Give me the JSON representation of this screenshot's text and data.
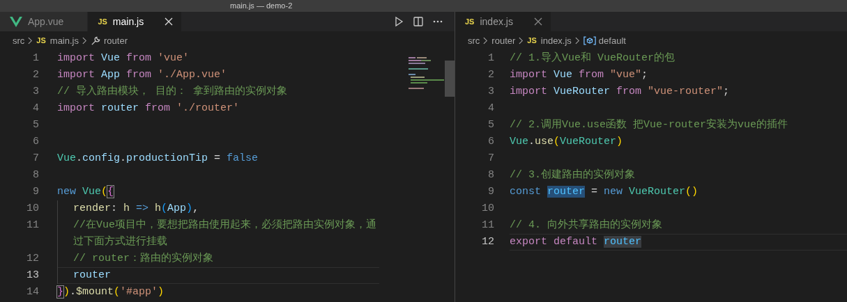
{
  "window": {
    "title": "main.js — demo-2"
  },
  "panes": [
    {
      "focused": true,
      "minimap": true,
      "actions": true,
      "tabs": [
        {
          "label": "App.vue",
          "kind": "vue",
          "selected": false,
          "closable": false
        },
        {
          "label": "main.js",
          "kind": "js",
          "icon_text": "JS",
          "selected": true,
          "closable": true
        }
      ],
      "breadcrumbs": [
        {
          "label": "src",
          "kind": "folder"
        },
        {
          "label": "main.js",
          "kind": "file",
          "icon_text": "JS"
        },
        {
          "label": "router",
          "kind": "property"
        }
      ],
      "lines": [
        {
          "number": "1",
          "current": false,
          "guide": false,
          "tokens": [
            {
              "text": "import ",
              "kind": "keyword"
            },
            {
              "text": "Vue ",
              "kind": "ident"
            },
            {
              "text": "from ",
              "kind": "keyword"
            },
            {
              "text": "'vue'",
              "kind": "string"
            }
          ]
        },
        {
          "number": "2",
          "current": false,
          "guide": false,
          "tokens": [
            {
              "text": "import ",
              "kind": "keyword"
            },
            {
              "text": "App ",
              "kind": "ident"
            },
            {
              "text": "from ",
              "kind": "keyword"
            },
            {
              "text": "'./App.vue'",
              "kind": "string"
            }
          ]
        },
        {
          "number": "3",
          "current": false,
          "guide": false,
          "tokens": [
            {
              "text": "// 导入路由模块， 目的： 拿到路由的实例对象",
              "kind": "comment"
            }
          ]
        },
        {
          "number": "4",
          "current": false,
          "guide": false,
          "tokens": [
            {
              "text": "import ",
              "kind": "keyword"
            },
            {
              "text": "router ",
              "kind": "ident"
            },
            {
              "text": "from ",
              "kind": "keyword"
            },
            {
              "text": "'./router'",
              "kind": "string"
            }
          ]
        },
        {
          "number": "5",
          "current": false,
          "guide": false
        },
        {
          "number": "6",
          "current": false,
          "guide": false
        },
        {
          "number": "7",
          "current": false,
          "guide": false,
          "tokens": [
            {
              "text": "Vue",
              "kind": "class"
            },
            {
              "text": ".",
              "kind": "plain"
            },
            {
              "text": "config",
              "kind": "ident"
            },
            {
              "text": ".",
              "kind": "plain"
            },
            {
              "text": "productionTip",
              "kind": "ident"
            },
            {
              "text": " = ",
              "kind": "plain"
            },
            {
              "text": "false",
              "kind": "storage"
            }
          ]
        },
        {
          "number": "8",
          "current": false,
          "guide": false
        },
        {
          "number": "9",
          "current": false,
          "guide": false,
          "tokens": [
            {
              "text": "new ",
              "kind": "storage"
            },
            {
              "text": "Vue",
              "kind": "class"
            },
            {
              "text": "(",
              "kind": "paren"
            },
            {
              "text": "{",
              "kind": "brace",
              "matched": true
            }
          ]
        },
        {
          "number": "10",
          "current": false,
          "guide": true,
          "tokens": [
            {
              "text": "render",
              "kind": "func"
            },
            {
              "text": ": ",
              "kind": "plain"
            },
            {
              "text": "h ",
              "kind": "func"
            },
            {
              "text": "=> ",
              "kind": "storage"
            },
            {
              "text": "h",
              "kind": "func"
            },
            {
              "text": "(",
              "kind": "paren2"
            },
            {
              "text": "App",
              "kind": "ident"
            },
            {
              "text": ")",
              "kind": "paren2"
            },
            {
              "text": ",",
              "kind": "plain"
            }
          ]
        },
        {
          "number": "11",
          "current": false,
          "guide": true,
          "tokens": [
            {
              "text": "//在Vue项目中，要想把路由使用起来，必须把路由实例对象，通过下面方式进行挂载",
              "kind": "comment"
            }
          ]
        },
        {
          "number": "12",
          "current": false,
          "guide": true,
          "tokens": [
            {
              "text": "// router：路由的实例对象",
              "kind": "comment"
            }
          ]
        },
        {
          "number": "13",
          "current": true,
          "guide": true,
          "tokens": [
            {
              "text": "router",
              "kind": "ident"
            }
          ]
        },
        {
          "number": "14",
          "current": false,
          "guide": false,
          "tokens": [
            {
              "text": "}",
              "kind": "brace",
              "matched": true
            },
            {
              "text": ")",
              "kind": "paren"
            },
            {
              "text": ".",
              "kind": "plain"
            },
            {
              "text": "$mount",
              "kind": "func"
            },
            {
              "text": "(",
              "kind": "paren"
            },
            {
              "text": "'#app'",
              "kind": "string"
            },
            {
              "text": ")",
              "kind": "paren"
            }
          ]
        }
      ]
    },
    {
      "focused": false,
      "minimap": false,
      "actions": false,
      "tabs": [
        {
          "label": "index.js",
          "kind": "js",
          "icon_text": "JS",
          "selected": true,
          "closable": true
        }
      ],
      "breadcrumbs": [
        {
          "label": "src",
          "kind": "folder"
        },
        {
          "label": "router",
          "kind": "folder"
        },
        {
          "label": "index.js",
          "kind": "file",
          "icon_text": "JS"
        },
        {
          "label": "default",
          "kind": "variable"
        }
      ],
      "lines": [
        {
          "number": "1",
          "current": false,
          "guide": false,
          "tokens": [
            {
              "text": "// 1.导入Vue和 VueRouter的包",
              "kind": "comment"
            }
          ]
        },
        {
          "number": "2",
          "current": false,
          "guide": false,
          "tokens": [
            {
              "text": "import ",
              "kind": "keyword"
            },
            {
              "text": "Vue ",
              "kind": "ident"
            },
            {
              "text": "from ",
              "kind": "keyword"
            },
            {
              "text": "\"vue\"",
              "kind": "string"
            },
            {
              "text": ";",
              "kind": "plain"
            }
          ]
        },
        {
          "number": "3",
          "current": false,
          "guide": false,
          "tokens": [
            {
              "text": "import ",
              "kind": "keyword"
            },
            {
              "text": "VueRouter ",
              "kind": "ident"
            },
            {
              "text": "from ",
              "kind": "keyword"
            },
            {
              "text": "\"vue-router\"",
              "kind": "string"
            },
            {
              "text": ";",
              "kind": "plain"
            }
          ]
        },
        {
          "number": "4",
          "current": false,
          "guide": false
        },
        {
          "number": "5",
          "current": false,
          "guide": false,
          "tokens": [
            {
              "text": "// 2.调用Vue.use函数 把Vue-router安装为vue的插件",
              "kind": "comment"
            }
          ]
        },
        {
          "number": "6",
          "current": false,
          "guide": false,
          "tokens": [
            {
              "text": "Vue",
              "kind": "class"
            },
            {
              "text": ".",
              "kind": "plain"
            },
            {
              "text": "use",
              "kind": "func"
            },
            {
              "text": "(",
              "kind": "paren"
            },
            {
              "text": "VueRouter",
              "kind": "class"
            },
            {
              "text": ")",
              "kind": "paren"
            }
          ]
        },
        {
          "number": "7",
          "current": false,
          "guide": false
        },
        {
          "number": "8",
          "current": false,
          "guide": false,
          "tokens": [
            {
              "text": "// 3.创建路由的实例对象",
              "kind": "comment"
            }
          ]
        },
        {
          "number": "9",
          "current": false,
          "guide": false,
          "tokens": [
            {
              "text": "const ",
              "kind": "storage"
            },
            {
              "text": "router",
              "kind": "const",
              "selected": true
            },
            {
              "text": " = ",
              "kind": "plain"
            },
            {
              "text": "new ",
              "kind": "storage"
            },
            {
              "text": "VueRouter",
              "kind": "class"
            },
            {
              "text": "()",
              "kind": "paren"
            }
          ]
        },
        {
          "number": "10",
          "current": false,
          "guide": false
        },
        {
          "number": "11",
          "current": false,
          "guide": false,
          "tokens": [
            {
              "text": "// 4. 向外共享路由的实例对象",
              "kind": "comment"
            }
          ]
        },
        {
          "number": "12",
          "current": true,
          "guide": false,
          "tokens": [
            {
              "text": "export ",
              "kind": "keyword"
            },
            {
              "text": "default ",
              "kind": "keyword"
            },
            {
              "text": "router",
              "kind": "const",
              "occurrence": true
            }
          ]
        }
      ]
    }
  ]
}
